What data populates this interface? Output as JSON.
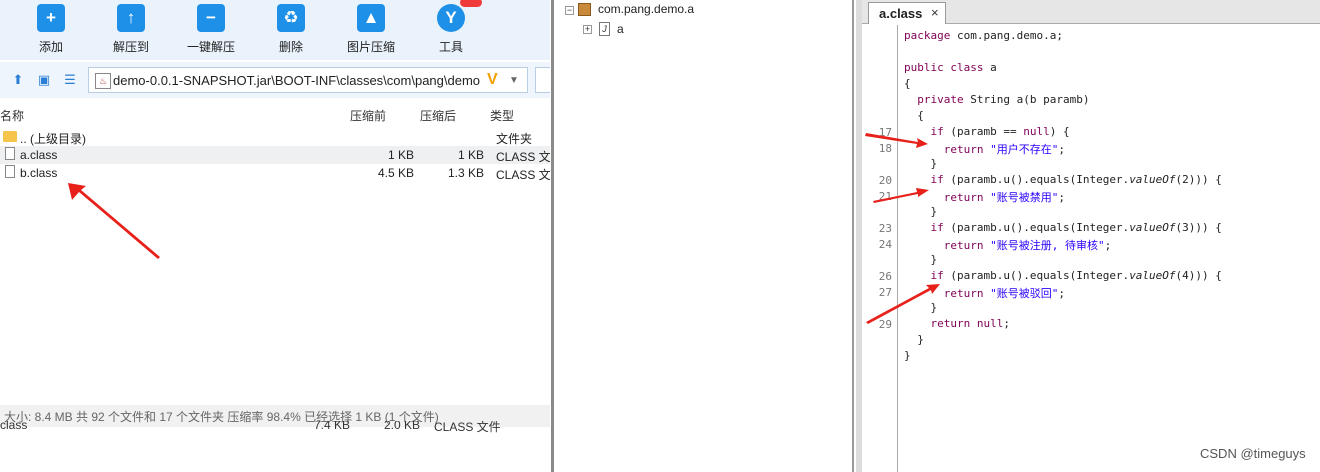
{
  "archive": {
    "toolbar": [
      {
        "label": "添加",
        "icon": "plus-icon"
      },
      {
        "label": "解压到",
        "icon": "extract-to-icon"
      },
      {
        "label": "一键解压",
        "icon": "one-click-extract-icon"
      },
      {
        "label": "删除",
        "icon": "recycle-icon"
      },
      {
        "label": "图片压缩",
        "icon": "image-compress-icon"
      },
      {
        "label": "工具",
        "icon": "tools-icon"
      }
    ],
    "path": "demo-0.0.1-SNAPSHOT.jar\\BOOT-INF\\classes\\com\\pang\\demo",
    "columns": {
      "name": "名称",
      "compressed": "压缩前",
      "packed": "压缩后",
      "type": "类型"
    },
    "rows": [
      {
        "name": ".. (上级目录)",
        "before": "",
        "after": "",
        "type": "文件夹",
        "icon": "folder-icon"
      },
      {
        "name": "a.class",
        "before": "1 KB",
        "after": "1 KB",
        "type": "CLASS 文件",
        "icon": "file-icon"
      },
      {
        "name": "b.class",
        "before": "4.5 KB",
        "after": "1.3 KB",
        "type": "CLASS 文件",
        "icon": "file-icon"
      }
    ],
    "status": "大小: 8.4 MB 共 92 个文件和 17 个文件夹 压缩率 98.4% 已经选择 1 KB (1 个文件)",
    "below_row": {
      "name": "class",
      "before": "7.4 KB",
      "after": "2.0 KB",
      "type": "CLASS 文件"
    }
  },
  "tree": {
    "package": "com.pang.demo.a",
    "child": "a"
  },
  "editor": {
    "tab": "a.class",
    "close": "×",
    "line_numbers": [
      "17",
      "18",
      "20",
      "21",
      "23",
      "24",
      "26",
      "27",
      "29"
    ]
  },
  "watermark": "CSDN @timeguys",
  "colors": {
    "arrow": "#e8201a",
    "toolbar_bg": "#eaf3fc",
    "icon_blue": "#1e90e8"
  }
}
